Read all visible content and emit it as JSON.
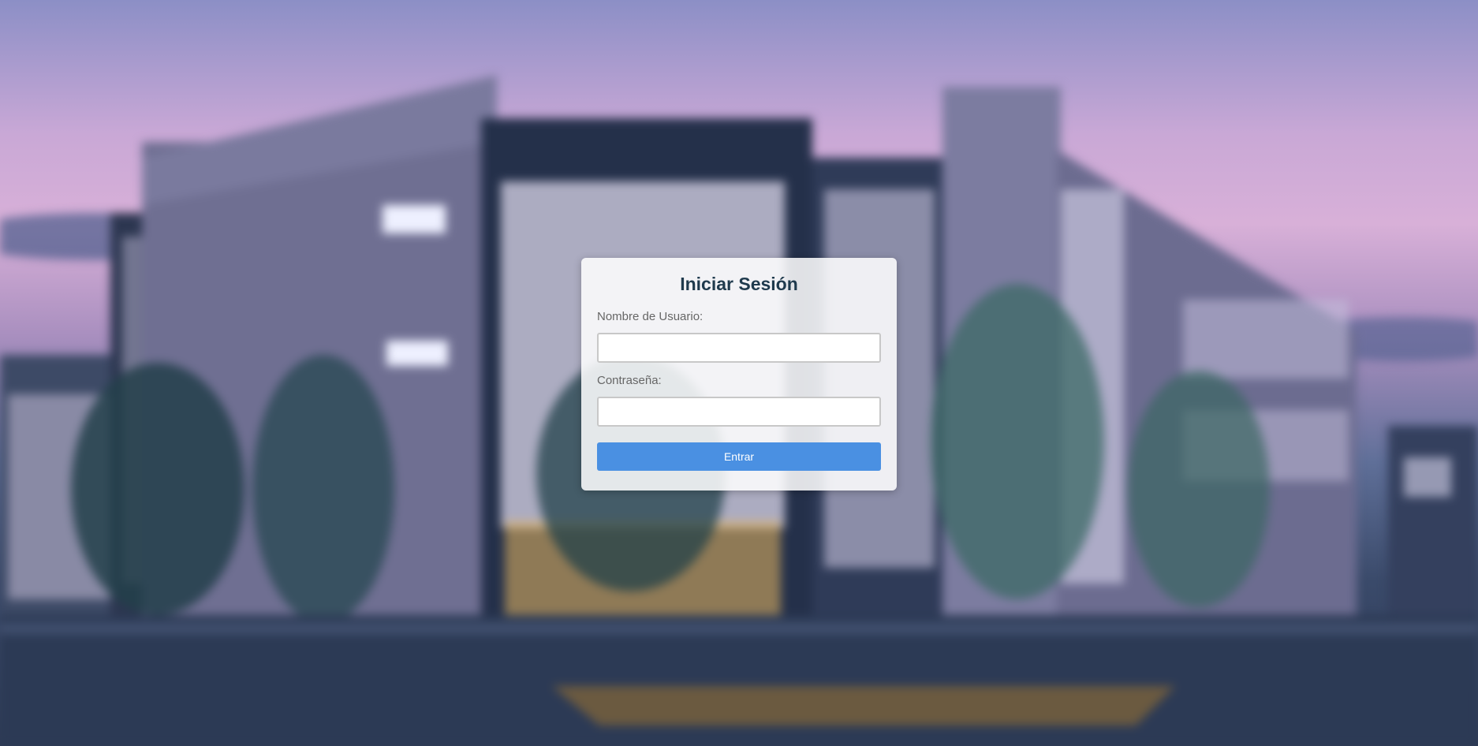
{
  "login": {
    "title": "Iniciar Sesión",
    "username_label": "Nombre de Usuario:",
    "username_value": "",
    "password_label": "Contraseña:",
    "password_value": "",
    "submit_label": "Entrar"
  },
  "colors": {
    "button": "#4a90e2",
    "title": "#1f3a4d"
  }
}
